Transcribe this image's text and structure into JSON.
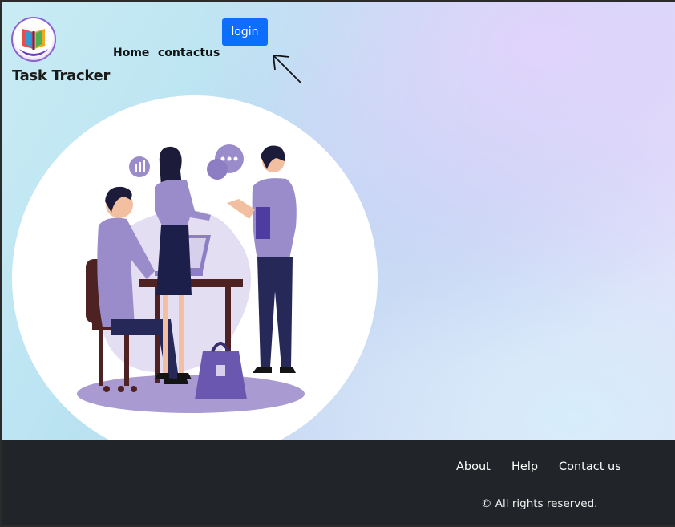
{
  "header": {
    "brand": "Task Tracker",
    "logo_icon": "book-logo-icon",
    "nav": [
      {
        "label": "Home"
      },
      {
        "label": "contactus"
      }
    ],
    "login_label": "login"
  },
  "hero": {
    "illustration": "team-meeting-illustration"
  },
  "footer": {
    "links": [
      {
        "label": "About"
      },
      {
        "label": "Help"
      },
      {
        "label": "Contact us"
      }
    ],
    "copyright": "© All rights reserved."
  },
  "colors": {
    "primary": "#0d6efd",
    "footer_bg": "#212529",
    "illustration_purple": "#8c7cc4"
  }
}
